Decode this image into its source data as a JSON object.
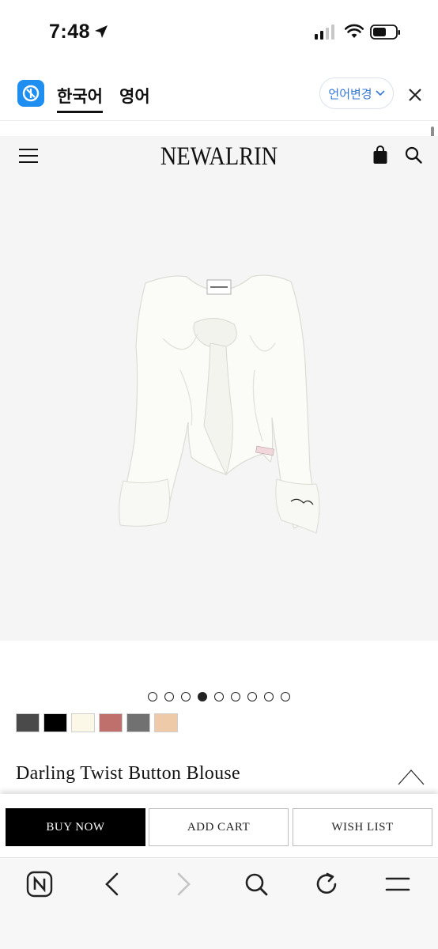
{
  "status_bar": {
    "time": "7:48"
  },
  "translate_bar": {
    "tabs": [
      {
        "label": "한국어",
        "active": true
      },
      {
        "label": "영어",
        "active": false
      }
    ],
    "change_button": "언어변경",
    "logo_icon": "translate-logo-icon",
    "close_icon": "close-icon"
  },
  "site": {
    "brand": "NEWALRIN",
    "menu_icon": "hamburger-menu-icon",
    "cart_icon": "shopping-bag-icon",
    "search_icon": "search-icon"
  },
  "product": {
    "title": "Darling Twist Button Blouse",
    "image_count": 9,
    "active_image": 4,
    "swatches": [
      {
        "color": "#4a4a4a"
      },
      {
        "color": "#000000"
      },
      {
        "color": "#fbf8e8"
      },
      {
        "color": "#c0706c"
      },
      {
        "color": "#717171"
      },
      {
        "color": "#efcaa8"
      }
    ]
  },
  "actions": {
    "buy_now": "BUY NOW",
    "add_cart": "ADD CART",
    "wish_list": "WISH LIST"
  },
  "browser_toolbar": {
    "icons": [
      "naver-home-icon",
      "back-icon",
      "forward-icon",
      "search-icon",
      "reload-icon",
      "menu-icon"
    ]
  },
  "colors": {
    "accent": "#1e8ff0",
    "link": "#3478d4",
    "primary_button": "#000000"
  }
}
